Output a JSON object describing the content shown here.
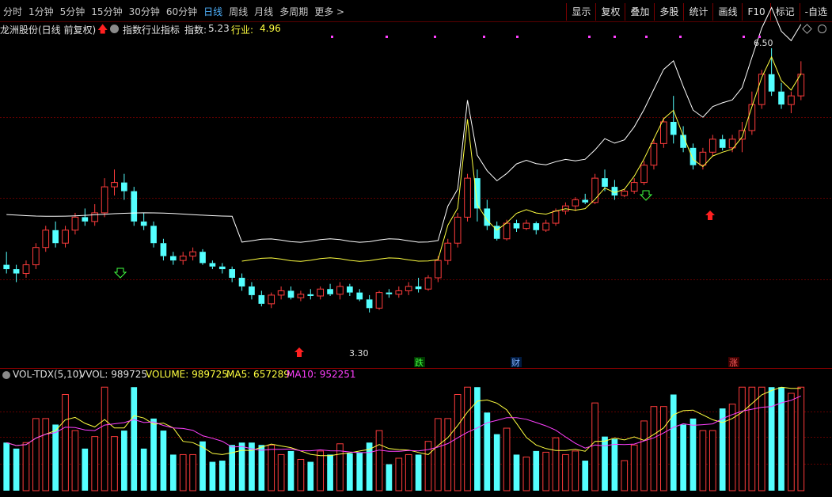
{
  "toolbar": {
    "periods": [
      "分时",
      "1分钟",
      "5分钟",
      "15分钟",
      "30分钟",
      "60分钟",
      "日线",
      "周线",
      "月线",
      "多周期",
      "更多 >"
    ],
    "active_period": "日线",
    "tools": [
      "显示",
      "复权",
      "叠加",
      "多股",
      "统计",
      "画线",
      "F10",
      "标记",
      "-自选"
    ]
  },
  "infobar": {
    "stock": "龙洲股份(日线 前复权)",
    "indicator": "指数行业指标",
    "index_label": "指数:",
    "index_value": "5.23",
    "industry_label": "行业:",
    "industry_value": "4.96"
  },
  "price_chart": {
    "high_label": "6.50",
    "low_label": "3.30",
    "event_labels": [
      "跌",
      "财",
      "涨"
    ]
  },
  "volume": {
    "title": "VOL-TDX(5,10)",
    "vvol": "VVOL: 989725",
    "volume": "VOLUME: 989725",
    "ma5": "MA5: 657289",
    "ma10": "MA10: 952251"
  },
  "colors": {
    "up": "#ff3c3c",
    "down": "#54ffff",
    "ma5": "#ffff40",
    "ma10": "#ff40ff",
    "index_line": "#ffffff",
    "industry_line": "#ffff40"
  },
  "chart_data": {
    "type": "candlestick",
    "price_ylim": [
      3.0,
      6.7
    ],
    "candles": [
      [
        4.1,
        4.25,
        4.0,
        4.05
      ],
      [
        4.05,
        4.1,
        3.9,
        4.0
      ],
      [
        4.0,
        4.15,
        3.95,
        4.1
      ],
      [
        4.1,
        4.35,
        4.05,
        4.3
      ],
      [
        4.3,
        4.55,
        4.25,
        4.5
      ],
      [
        4.5,
        4.6,
        4.3,
        4.35
      ],
      [
        4.35,
        4.55,
        4.3,
        4.5
      ],
      [
        4.5,
        4.7,
        4.45,
        4.65
      ],
      [
        4.65,
        4.75,
        4.55,
        4.6
      ],
      [
        4.6,
        4.8,
        4.55,
        4.7
      ],
      [
        4.7,
        5.1,
        4.65,
        5.0
      ],
      [
        5.0,
        5.2,
        4.9,
        5.05
      ],
      [
        5.05,
        5.15,
        4.85,
        4.95
      ],
      [
        4.95,
        5.0,
        4.55,
        4.6
      ],
      [
        4.6,
        4.7,
        4.5,
        4.55
      ],
      [
        4.55,
        4.6,
        4.3,
        4.35
      ],
      [
        4.35,
        4.4,
        4.15,
        4.2
      ],
      [
        4.2,
        4.25,
        4.1,
        4.15
      ],
      [
        4.15,
        4.25,
        4.1,
        4.2
      ],
      [
        4.2,
        4.3,
        4.15,
        4.25
      ],
      [
        4.25,
        4.28,
        4.1,
        4.12
      ],
      [
        4.12,
        4.15,
        4.05,
        4.08
      ],
      [
        4.08,
        4.12,
        4.0,
        4.05
      ],
      [
        4.05,
        4.08,
        3.9,
        3.95
      ],
      [
        3.95,
        4.0,
        3.8,
        3.85
      ],
      [
        3.85,
        3.9,
        3.7,
        3.75
      ],
      [
        3.75,
        3.8,
        3.62,
        3.65
      ],
      [
        3.65,
        3.78,
        3.6,
        3.75
      ],
      [
        3.75,
        3.85,
        3.7,
        3.8
      ],
      [
        3.8,
        3.85,
        3.7,
        3.72
      ],
      [
        3.72,
        3.8,
        3.68,
        3.76
      ],
      [
        3.76,
        3.82,
        3.7,
        3.74
      ],
      [
        3.74,
        3.85,
        3.7,
        3.82
      ],
      [
        3.82,
        3.88,
        3.74,
        3.76
      ],
      [
        3.76,
        3.9,
        3.7,
        3.85
      ],
      [
        3.85,
        3.88,
        3.74,
        3.78
      ],
      [
        3.78,
        3.82,
        3.68,
        3.7
      ],
      [
        3.7,
        3.75,
        3.55,
        3.6
      ],
      [
        3.6,
        3.8,
        3.58,
        3.78
      ],
      [
        3.78,
        3.82,
        3.72,
        3.76
      ],
      [
        3.76,
        3.85,
        3.72,
        3.8
      ],
      [
        3.8,
        3.9,
        3.75,
        3.85
      ],
      [
        3.85,
        3.95,
        3.78,
        3.82
      ],
      [
        3.82,
        3.98,
        3.8,
        3.95
      ],
      [
        3.95,
        4.2,
        3.9,
        4.15
      ],
      [
        4.15,
        4.4,
        4.1,
        4.35
      ],
      [
        4.35,
        4.7,
        4.3,
        4.65
      ],
      [
        4.65,
        5.15,
        4.6,
        5.1
      ],
      [
        5.1,
        5.2,
        4.6,
        4.75
      ],
      [
        4.75,
        4.85,
        4.5,
        4.55
      ],
      [
        4.55,
        4.6,
        4.38,
        4.4
      ],
      [
        4.4,
        4.62,
        4.38,
        4.58
      ],
      [
        4.58,
        4.62,
        4.48,
        4.52
      ],
      [
        4.52,
        4.62,
        4.5,
        4.58
      ],
      [
        4.58,
        4.6,
        4.45,
        4.5
      ],
      [
        4.5,
        4.62,
        4.48,
        4.58
      ],
      [
        4.58,
        4.75,
        4.55,
        4.72
      ],
      [
        4.72,
        4.82,
        4.68,
        4.78
      ],
      [
        4.78,
        4.88,
        4.72,
        4.85
      ],
      [
        4.85,
        4.92,
        4.8,
        4.82
      ],
      [
        4.82,
        5.15,
        4.8,
        5.1
      ],
      [
        5.1,
        5.2,
        4.95,
        5.0
      ],
      [
        5.0,
        5.08,
        4.85,
        4.9
      ],
      [
        4.9,
        4.98,
        4.88,
        4.95
      ],
      [
        4.95,
        5.1,
        4.92,
        5.05
      ],
      [
        5.05,
        5.3,
        5.02,
        5.25
      ],
      [
        5.25,
        5.55,
        5.2,
        5.5
      ],
      [
        5.5,
        5.8,
        5.45,
        5.75
      ],
      [
        5.75,
        6.05,
        5.5,
        5.6
      ],
      [
        5.6,
        5.7,
        5.4,
        5.45
      ],
      [
        5.45,
        5.5,
        5.2,
        5.25
      ],
      [
        5.25,
        5.45,
        5.2,
        5.4
      ],
      [
        5.4,
        5.6,
        5.35,
        5.55
      ],
      [
        5.55,
        5.6,
        5.42,
        5.45
      ],
      [
        5.45,
        5.6,
        5.4,
        5.55
      ],
      [
        5.55,
        5.75,
        5.4,
        5.65
      ],
      [
        5.65,
        6.1,
        5.6,
        5.95
      ],
      [
        5.95,
        6.35,
        5.9,
        6.3
      ],
      [
        6.3,
        6.6,
        6.05,
        6.1
      ],
      [
        6.1,
        6.2,
        5.9,
        5.95
      ],
      [
        5.95,
        6.1,
        5.85,
        6.05
      ],
      [
        6.05,
        6.45,
        6.0,
        6.3
      ]
    ],
    "volume_ylim": [
      0,
      1600000
    ]
  }
}
